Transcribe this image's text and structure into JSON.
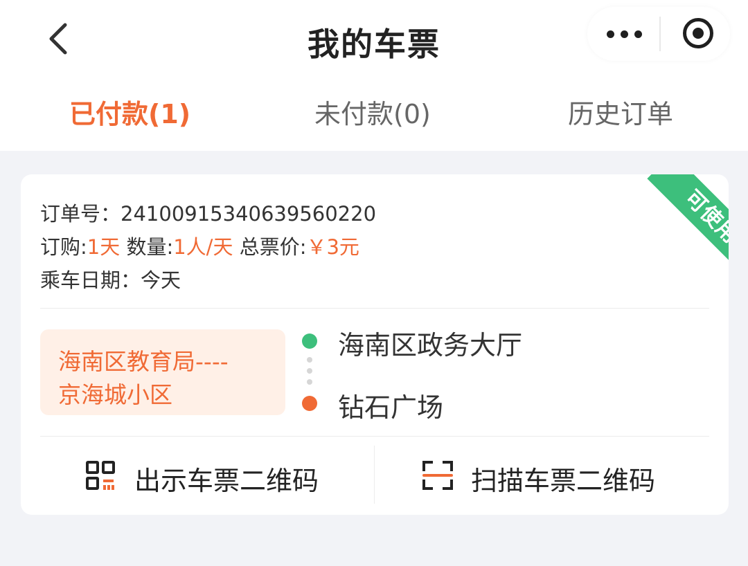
{
  "header": {
    "title": "我的车票",
    "back_icon": "chevron-left-icon",
    "more_icon": "more-dots-icon",
    "close_icon": "target-close-icon"
  },
  "tabs": [
    {
      "label": "已付款(1)",
      "active": true
    },
    {
      "label": "未付款(0)",
      "active": false
    },
    {
      "label": "历史订单",
      "active": false
    }
  ],
  "ticket": {
    "status_badge": "可使用",
    "order_label": "订单号：",
    "order_number": "24100915340639560220",
    "purchase_label": "订购:",
    "purchase_value": "1天",
    "quantity_label": "数量:",
    "quantity_value": "1人/天",
    "total_label": "总票价:",
    "total_value": "￥3元",
    "ride_date_label": "乘车日期：",
    "ride_date_value": "今天",
    "route_name_line1": "海南区教育局----",
    "route_name_line2": "京海城小区",
    "start_stop": "海南区政务大厅",
    "end_stop": "钻石广场",
    "show_qr_label": "出示车票二维码",
    "scan_qr_label": "扫描车票二维码"
  },
  "colors": {
    "accent": "#f06a35",
    "success": "#3dbf7c",
    "background": "#f2f3f7",
    "route_tag_bg": "#fff0e7"
  }
}
